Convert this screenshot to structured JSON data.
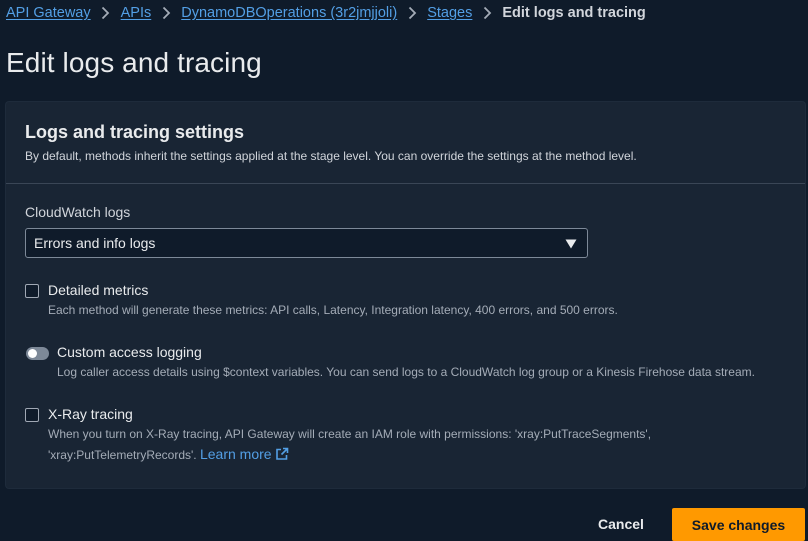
{
  "breadcrumb": {
    "items": [
      {
        "label": "API Gateway"
      },
      {
        "label": "APIs"
      },
      {
        "label": "DynamoDBOperations (3r2jmjjoli)"
      },
      {
        "label": "Stages"
      }
    ],
    "current": "Edit logs and tracing"
  },
  "page": {
    "title": "Edit logs and tracing"
  },
  "panel": {
    "title": "Logs and tracing settings",
    "description": "By default, methods inherit the settings applied at the stage level. You can override the settings at the method level.",
    "cloudwatch": {
      "label": "CloudWatch logs",
      "selected": "Errors and info logs"
    },
    "detailed_metrics": {
      "label": "Detailed metrics",
      "description": "Each method will generate these metrics: API calls, Latency, Integration latency, 400 errors, and 500 errors.",
      "checked": false
    },
    "custom_access_logging": {
      "label": "Custom access logging",
      "description": "Log caller access details using $context variables. You can send logs to a CloudWatch log group or a Kinesis Firehose data stream.",
      "enabled": false
    },
    "xray": {
      "label": "X-Ray tracing",
      "description_line1": "When you turn on X-Ray tracing, API Gateway will create an IAM role with permissions: 'xray:PutTraceSegments',",
      "description_line2": "'xray:PutTelemetryRecords'.",
      "learn_more": "Learn more",
      "checked": false
    }
  },
  "actions": {
    "cancel": "Cancel",
    "save": "Save changes"
  },
  "colors": {
    "background": "#0f1b2a",
    "panel": "#192534",
    "link": "#539fe5",
    "primary": "#ff9900"
  },
  "icons": {
    "separator": "chevron-right-icon",
    "select": "caret-down-icon",
    "external": "external-link-icon"
  }
}
